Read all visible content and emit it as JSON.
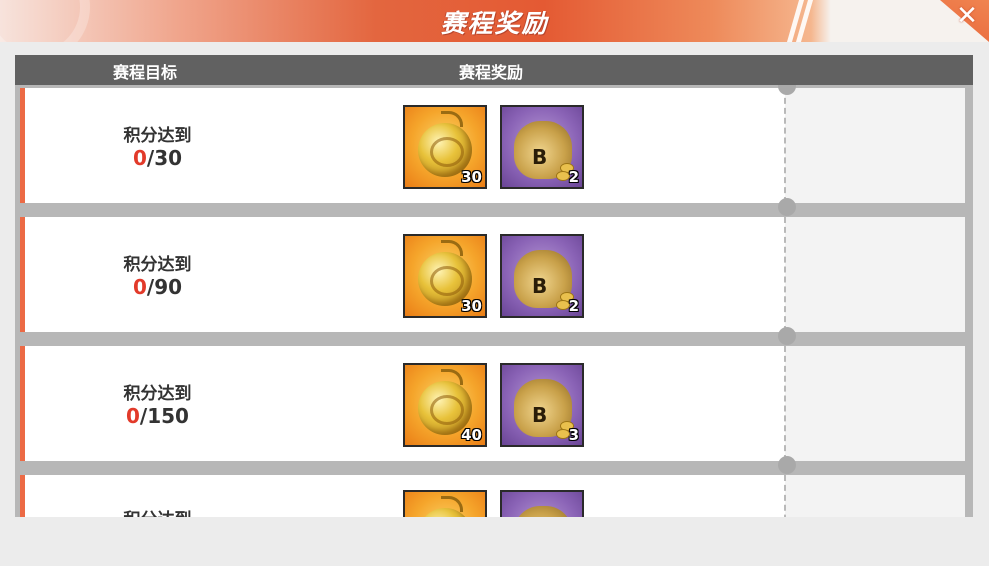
{
  "header": {
    "title": "赛程奖励"
  },
  "columns": {
    "goal": "赛程目标",
    "reward": "赛程奖励"
  },
  "icons": {
    "close": "close-icon",
    "fruit": "devil-fruit-icon",
    "bag": "coin-bag-icon"
  },
  "colors": {
    "accent": "#e45a33",
    "progress_current": "#e23a2a",
    "header_bar": "#616161"
  },
  "rows": [
    {
      "label": "积分达到",
      "current": "0",
      "target": "/30",
      "rewards": [
        {
          "item": "fruit",
          "count": "30"
        },
        {
          "item": "bag",
          "count": "2"
        }
      ]
    },
    {
      "label": "积分达到",
      "current": "0",
      "target": "/90",
      "rewards": [
        {
          "item": "fruit",
          "count": "30"
        },
        {
          "item": "bag",
          "count": "2"
        }
      ]
    },
    {
      "label": "积分达到",
      "current": "0",
      "target": "/150",
      "rewards": [
        {
          "item": "fruit",
          "count": "40"
        },
        {
          "item": "bag",
          "count": "3"
        }
      ]
    },
    {
      "label": "积分达到"
    }
  ]
}
